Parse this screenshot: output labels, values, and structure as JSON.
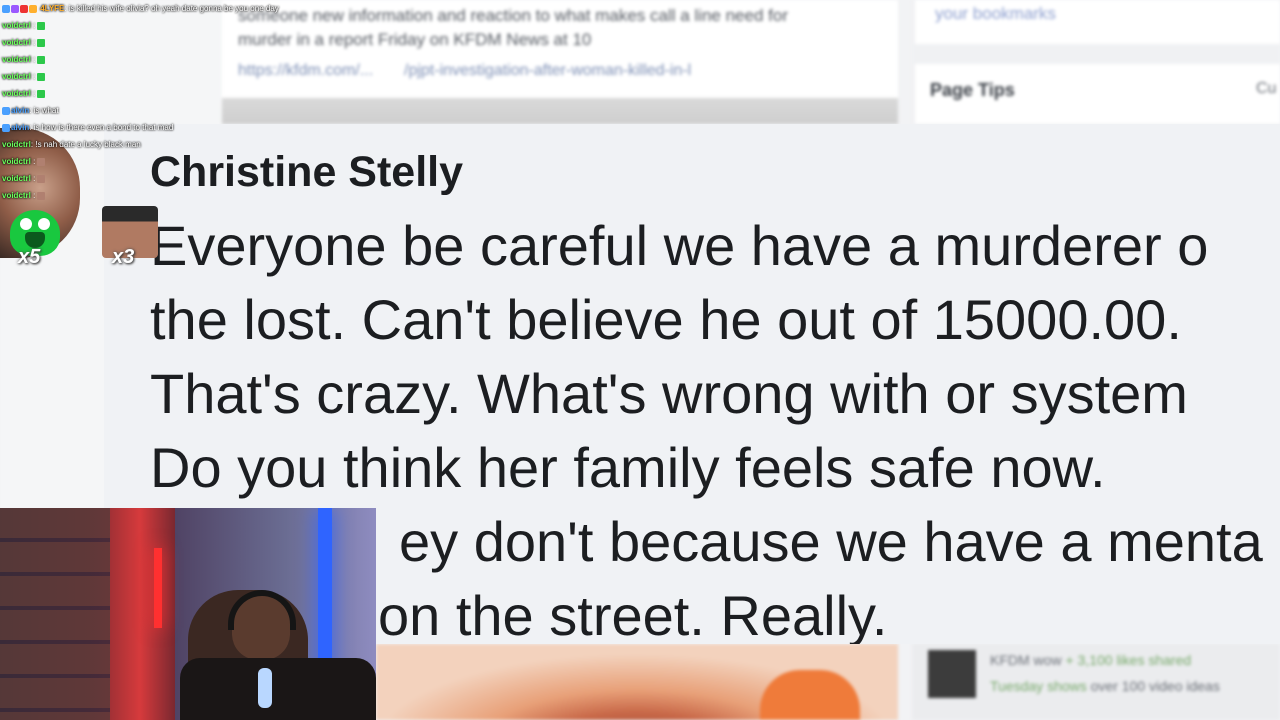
{
  "background": {
    "center_text_line1": "someone new information and reaction to what makes call a line need for",
    "center_text_line2": "murder in a report Friday on KFDM News at 10",
    "center_link1": "https://kfdm.com/...",
    "center_link2": "/pjpt-investigation-after-woman-killed-in-l",
    "right_link": "your bookmarks",
    "page_tips": "Page Tips",
    "page_tips_right": "Cu",
    "bottom_right_line1": "KFDM wow",
    "bottom_right_line1_green": "+ 3,100 likes shared",
    "bottom_right_line2": "Tuesday shows",
    "bottom_right_line2_rest": "over 100 video ideas"
  },
  "comment": {
    "author": "Christine Stelly",
    "lines": [
      "Everyone be careful we have a murderer o",
      "the lost. Can't believe he out of 15000.00.",
      "That's crazy. What's wrong with or system",
      "Do you think her family feels safe now.",
      "ey don't because we have a menta",
      "on the street. Really."
    ]
  },
  "chat": {
    "messages": [
      {
        "user": "4LYFE",
        "text": ": is killed his wife olivia? oh yeah date gonna be you one day"
      },
      {
        "user": "voidctrl",
        "text": ":"
      },
      {
        "user": "voidctrl",
        "text": ":"
      },
      {
        "user": "voidctrl",
        "text": ":"
      },
      {
        "user": "voidctrl",
        "text": ":"
      },
      {
        "user": "voidctrl",
        "text": ":"
      },
      {
        "user": "alvin",
        "text": ": is what"
      },
      {
        "user": "alvin",
        "text": ": is how is there even a bond to that mad"
      },
      {
        "user": "voidctrl",
        "text": ": !s nah date a lucky black man"
      },
      {
        "user": "voidctrl",
        "text": ":"
      },
      {
        "user": "voidctrl",
        "text": ":"
      },
      {
        "user": "voidctrl",
        "text": ":"
      }
    ]
  },
  "combos": {
    "green_count": "x5",
    "face_count": "x3"
  },
  "colors": {
    "comment_bg": "#f0f2f5",
    "comment_text": "#1c1e21",
    "chat_green_user": "#6aff5c",
    "chat_blue_user": "#4aa0ff",
    "chat_orange_user": "#ffb02e"
  }
}
